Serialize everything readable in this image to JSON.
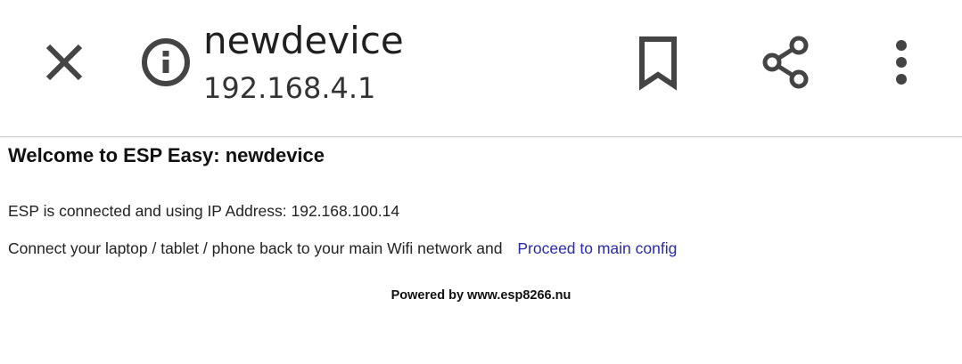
{
  "toolbar": {
    "title": "newdevice",
    "url": "192.168.4.1",
    "icons": {
      "close": "close-icon",
      "info": "info-icon",
      "bookmark": "bookmark-icon",
      "share": "share-icon",
      "menu": "more-vert-icon"
    },
    "icon_color": "#444444"
  },
  "page": {
    "heading": "Welcome to ESP Easy: newdevice",
    "connected_text": "ESP is connected and using IP Address: 192.168.100.14",
    "connect_back_text": "Connect your laptop / tablet / phone back to your main Wifi network and",
    "proceed_link": "Proceed to main config",
    "footer": "Powered by www.esp8266.nu",
    "link_color": "#2a2ab0"
  }
}
